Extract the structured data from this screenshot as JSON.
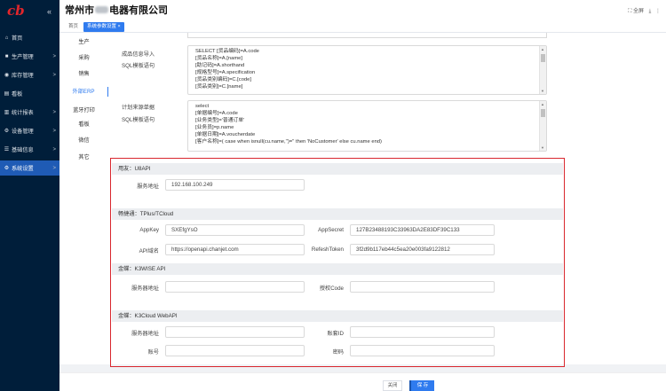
{
  "app": {
    "company_visible_prefix": "常州市",
    "company_visible_suffix": "电器有限公司",
    "collapse_icon": "«",
    "header_right": {
      "fullscreen": "全屏",
      "fullscreen_icon": "⛶",
      "download_icon": "⤓",
      "more_icon": "⋮"
    }
  },
  "sidebar": {
    "items": [
      {
        "label": "首页",
        "icon": "home-icon",
        "glyph": "⌂"
      },
      {
        "label": "生产管理",
        "icon": "production-icon",
        "glyph": "■"
      },
      {
        "label": "库存管理",
        "icon": "inventory-icon",
        "glyph": "◉"
      },
      {
        "label": "看板",
        "icon": "dashboard-icon",
        "glyph": "▤"
      },
      {
        "label": "统计报表",
        "icon": "chart-icon",
        "glyph": "▥"
      },
      {
        "label": "设备管理",
        "icon": "equipment-icon",
        "glyph": "⚙"
      },
      {
        "label": "基础信息",
        "icon": "basic-info-icon",
        "glyph": "☰"
      },
      {
        "label": "系统设置",
        "icon": "settings-icon",
        "glyph": "⚙",
        "active": true
      }
    ]
  },
  "tabs": {
    "home": "首页",
    "settings": "系统参数设置 ×"
  },
  "subnav": [
    "生产",
    "采购",
    "销售",
    "外部ERP",
    "蓝牙打印",
    "看板",
    "微信",
    "其它"
  ],
  "sql1": {
    "label_top": "成品信息导入",
    "label_bottom": "SQL模板语句",
    "lines": [
      "SELECT  [货品编码]=A.code",
      "[货品名称]=A.[name]",
      "[助记码]=A.shorthand",
      "[规格型号]=A.specification",
      "[货品类别编码]=C.[code]",
      "[货品类别]=C.[name]"
    ]
  },
  "sql2": {
    "label_top": "计划来源单据",
    "label_bottom": "SQL模板语句",
    "lines": [
      "select",
      "[单据编号]=A.code",
      "[业务类型]='普通订单'",
      "[业务员]=p.name",
      "[单据日期]=A.voucherdate",
      "[客户名称]=( case when isnull(cu.name,'')='' then 'NoCustomer' else cu.name end)"
    ]
  },
  "erp": {
    "u8": {
      "title": "用友：U8API",
      "addr_label": "服务地址",
      "addr_value": "192.168.100.249"
    },
    "tplus": {
      "title": "畅捷通：TPlus/TCloud",
      "appkey_label": "AppKey",
      "appkey_value": "SXEfgYsO",
      "appsecret_label": "AppSecret",
      "appsecret_value": "127B23488193C33963DA2E83DF39C133",
      "api_label": "API域名",
      "api_value": "https://openapi.chanjet.com",
      "token_label": "RefeshToken",
      "token_value": "3f2d9b117eb44c5ea20e003fa9122812"
    },
    "k3wise": {
      "title": "金蝶：K3WISE API",
      "addr_label": "服务器地址",
      "addr_value": "",
      "auth_label": "授权Code",
      "auth_value": ""
    },
    "k3cloud": {
      "title": "金蝶：K3Cloud WebAPI",
      "addr_label": "服务器地址",
      "addr_value": "",
      "acct_label": "账套ID",
      "acct_value": "",
      "user_label": "账号",
      "user_value": "",
      "pwd_label": "密码",
      "pwd_value": ""
    }
  },
  "footer": {
    "close": "关闭",
    "save": "保 存"
  },
  "colors": {
    "sidebar_bg": "#001e3a",
    "active": "#1f5bb5",
    "accent": "#2f7bef",
    "highlight_frame": "#d9272e",
    "logo": "#e3262b"
  }
}
